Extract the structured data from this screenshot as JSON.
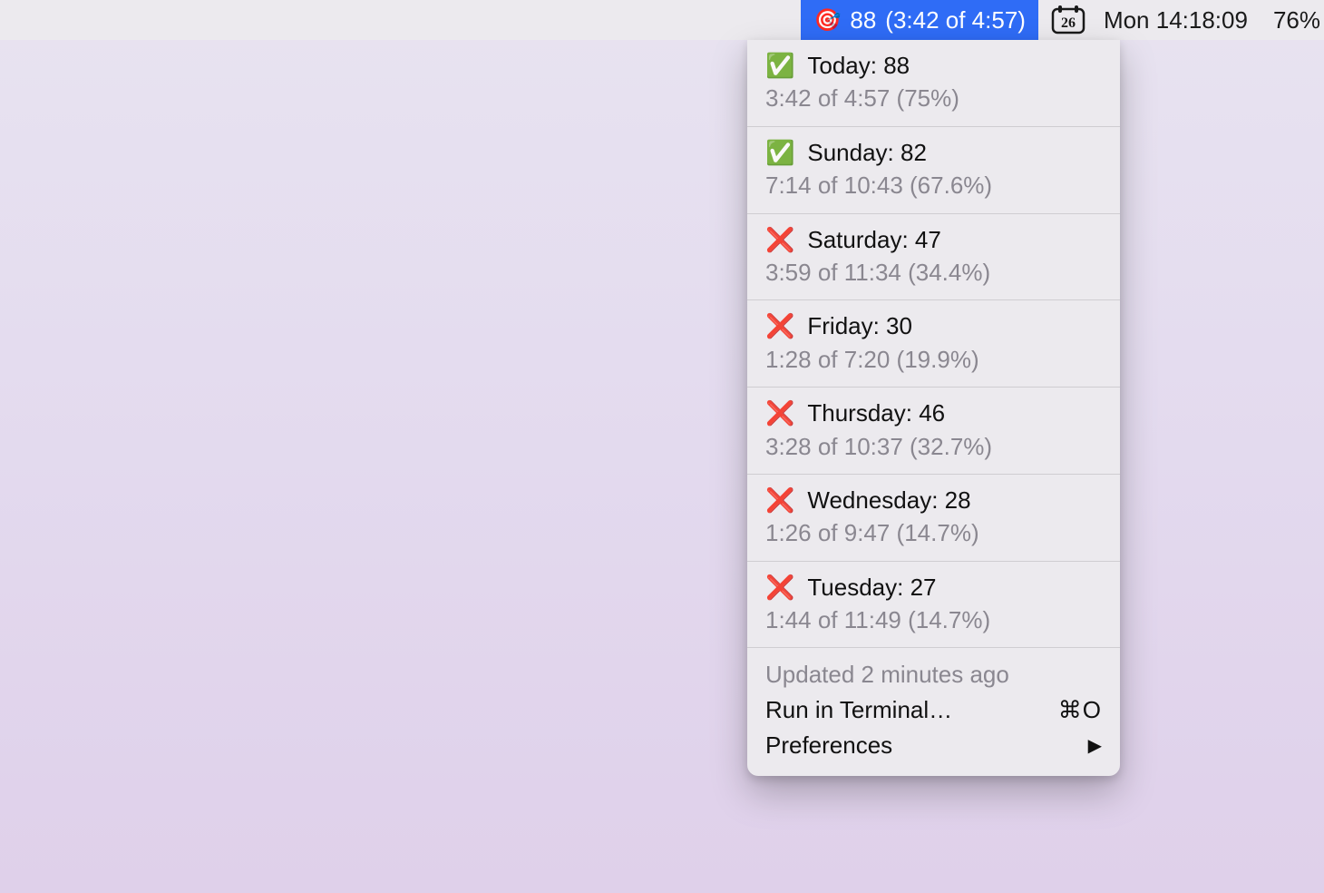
{
  "menubar": {
    "app": {
      "emoji": "🎯",
      "score": "88",
      "timing": "(3:42 of 4:57)"
    },
    "calendar_day": "26",
    "clock": "Mon 14:18:09",
    "battery": "76%"
  },
  "dropdown": {
    "days": [
      {
        "emoji": "✅",
        "label": "Today: 88",
        "sub": "3:42 of 4:57 (75%)"
      },
      {
        "emoji": "✅",
        "label": "Sunday: 82",
        "sub": "7:14 of 10:43 (67.6%)"
      },
      {
        "emoji": "❌",
        "label": "Saturday: 47",
        "sub": "3:59 of 11:34 (34.4%)"
      },
      {
        "emoji": "❌",
        "label": "Friday: 30",
        "sub": "1:28 of 7:20 (19.9%)"
      },
      {
        "emoji": "❌",
        "label": "Thursday: 46",
        "sub": "3:28 of 10:37 (32.7%)"
      },
      {
        "emoji": "❌",
        "label": "Wednesday: 28",
        "sub": "1:26 of 9:47 (14.7%)"
      },
      {
        "emoji": "❌",
        "label": "Tuesday: 27",
        "sub": "1:44 of 11:49 (14.7%)"
      }
    ],
    "updated": "Updated 2 minutes ago",
    "run_terminal": "Run in Terminal…",
    "run_terminal_shortcut": "⌘O",
    "preferences": "Preferences",
    "preferences_chevron": "▶"
  }
}
